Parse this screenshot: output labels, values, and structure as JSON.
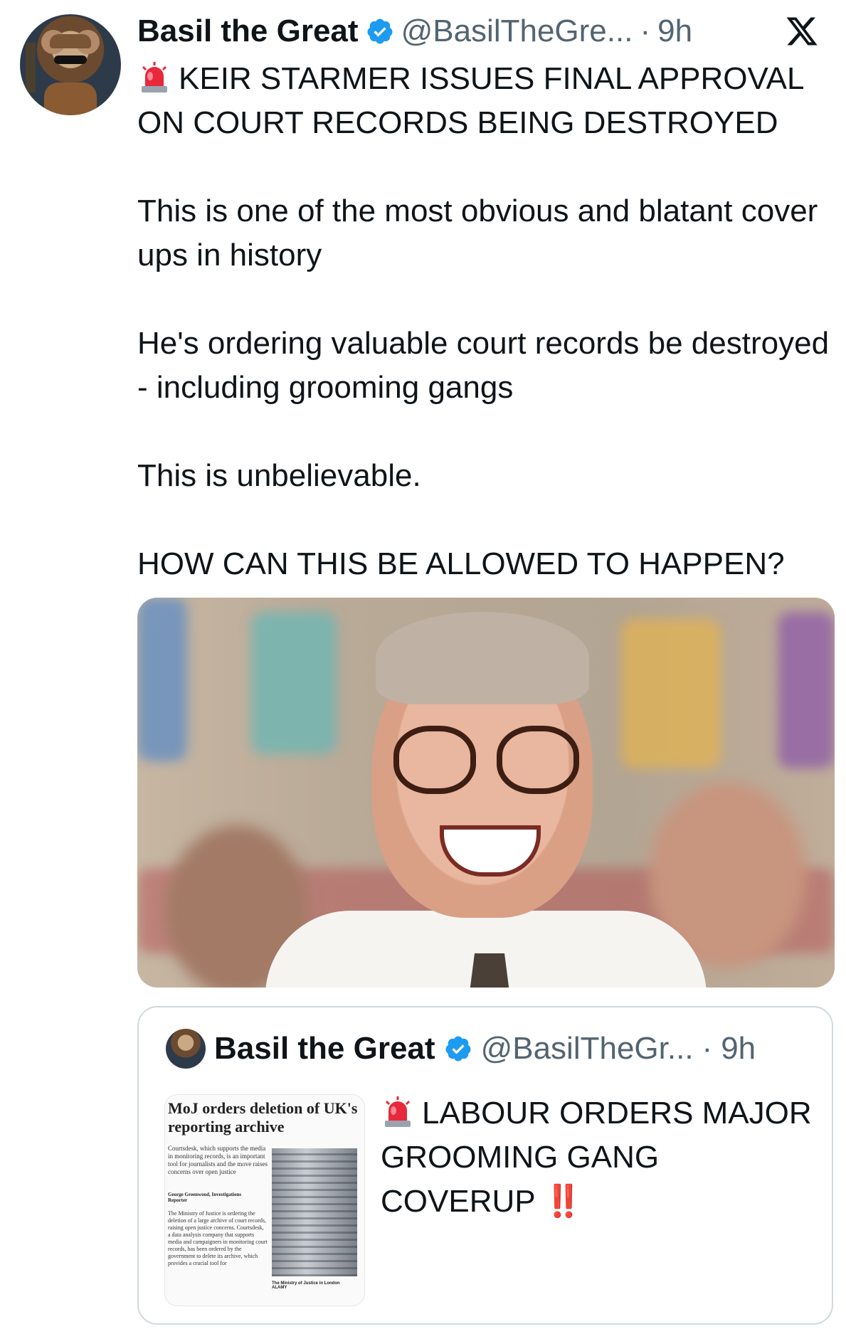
{
  "tweet": {
    "author_name": "Basil the Great",
    "handle": "@BasilTheGre...",
    "separator": "·",
    "time": "9h",
    "avatar_icon": "mouse-detective-avatar",
    "verified_icon": "verified-badge-icon",
    "verified_color": "#1d9bf0",
    "platform_icon": "x-logo-icon",
    "headline_emoji": "siren-emoji",
    "headline": "KEIR STARMER ISSUES FINAL APPROVAL ON COURT RECORDS BEING DESTROYED",
    "paragraphs": [
      "This is one of the most obvious and blatant cover ups in history",
      "He's ordering valuable court records be destroyed - including grooming gangs",
      "This is unbelievable.",
      "HOW CAN THIS BE ALLOWED TO HAPPEN?"
    ]
  },
  "quote": {
    "author_name": "Basil the Great",
    "handle": "@BasilTheGr...",
    "separator": "·",
    "time": "9h",
    "headline_emoji": "siren-emoji",
    "text": "LABOUR ORDERS MAJOR GROOMING GANG COVERUP",
    "suffix_emoji": "‼️",
    "suffix_color": "#e0245e",
    "thumbnail": {
      "headline": "MoJ orders deletion of UK's reporting archive",
      "body": "Courtsdesk, which supports the media in monitoring records, is an important tool for journalists and the move raises concerns over open justice",
      "byline": "George Greenwood, Investigations Reporter",
      "paragraph": "The Ministry of Justice is ordering the deletion of a large archive of court records, raising open justice concerns. Courtsdesk, a data analysis company that supports media and campaigners in monitoring court records, has been ordered by the government to delete its archive, which provides a crucial tool for",
      "caption": "The Ministry of Justice in London",
      "credit": "ALAMY"
    }
  }
}
